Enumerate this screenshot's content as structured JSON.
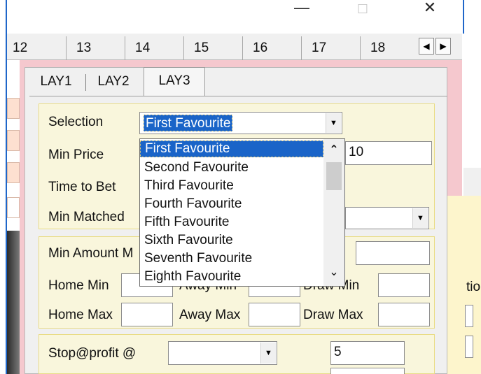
{
  "window": {
    "minimize_glyph": "—",
    "maximize_glyph": "☐",
    "close_glyph": "✕"
  },
  "tabs": [
    "12",
    "13",
    "14",
    "15",
    "16",
    "17",
    "18"
  ],
  "tab_scroll": {
    "left": "◀",
    "right": "▶"
  },
  "lay_tabs": [
    "LAY1",
    "LAY2",
    "LAY3"
  ],
  "selection": {
    "label": "Selection",
    "value": "First Favourite",
    "options": [
      "First Favourite",
      "Second Favourite",
      "Third Favourite",
      "Fourth Favourite",
      "Fifth Favourite",
      "Sixth Favourite",
      "Seventh Favourite",
      "Eighth Favourite"
    ],
    "selected_index": 0
  },
  "min_price": {
    "label": "Min Price",
    "value": "10"
  },
  "time_to_bet": {
    "label": "Time to Bet"
  },
  "min_matched": {
    "label": "Min Matched",
    "value": ""
  },
  "min_amount": {
    "label": "Min Amount M",
    "value": ""
  },
  "odds": {
    "home_min": "Home Min",
    "away_min": "Away Min",
    "draw_min": "Draw Min",
    "home_max": "Home Max",
    "away_max": "Away Max",
    "draw_max": "Draw Max"
  },
  "stop_profit": {
    "label": "Stop@profit @",
    "combo_value": "",
    "value": "5"
  },
  "right_label_fragment": "tio",
  "colors": {
    "accent": "#1a64c8",
    "panel_pink": "#f5c8ce",
    "section_yellow": "#f9f6dc",
    "window_border": "#1f66c9"
  }
}
